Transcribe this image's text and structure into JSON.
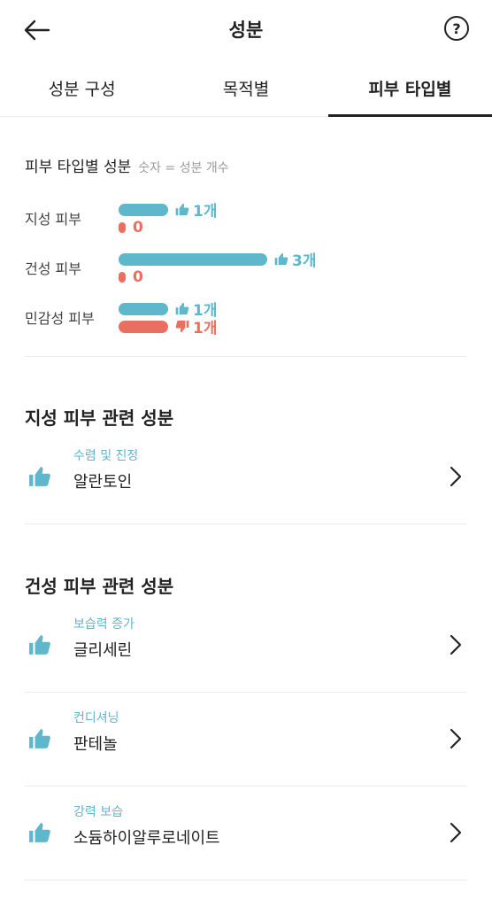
{
  "header": {
    "title": "성분",
    "help_label": "?"
  },
  "tabs": [
    {
      "label": "성분 구성",
      "active": false
    },
    {
      "label": "목적별",
      "active": false
    },
    {
      "label": "피부 타입별",
      "active": true
    }
  ],
  "summary": {
    "title": "피부 타입별 성분",
    "note": "숫자 = 성분 개수",
    "rows": [
      {
        "label": "지성 피부",
        "positive": 1,
        "negative": 0,
        "positive_text": "1개",
        "negative_text": "0"
      },
      {
        "label": "건성 피부",
        "positive": 3,
        "negative": 0,
        "positive_text": "3개",
        "negative_text": "0"
      },
      {
        "label": "민감성 피부",
        "positive": 1,
        "negative": 1,
        "positive_text": "1개",
        "negative_text": "1개"
      }
    ]
  },
  "sections": [
    {
      "title": "지성 피부 관련 성분",
      "items": [
        {
          "category": "수렴 및 진정",
          "name": "알란토인"
        }
      ]
    },
    {
      "title": "건성 피부 관련 성분",
      "items": [
        {
          "category": "보습력 증가",
          "name": "글리세린"
        },
        {
          "category": "컨디셔닝",
          "name": "판테놀"
        },
        {
          "category": "강력 보습",
          "name": "소듐하이알루로네이트"
        }
      ]
    }
  ],
  "colors": {
    "positive": "#5eb7cb",
    "negative": "#e9705f",
    "text": "#222222",
    "divider": "#ececec"
  },
  "icons": {
    "back": "arrow-left-icon",
    "help": "question-circle-icon",
    "good": "thumbs-up-icon",
    "bad": "thumbs-down-icon",
    "chevron": "chevron-right-icon"
  }
}
